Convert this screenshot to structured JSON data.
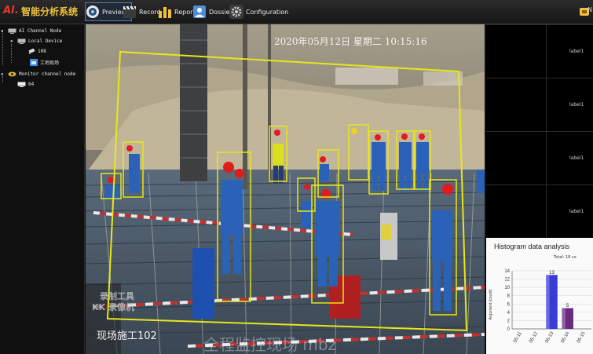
{
  "app": {
    "logo": "AI.",
    "title": "智能分析系统"
  },
  "nav": [
    {
      "label": "Preview",
      "icon": "camera-icon"
    },
    {
      "label": "Record",
      "icon": "clapperboard-icon"
    },
    {
      "label": "Report",
      "icon": "bar-chart-icon"
    },
    {
      "label": "Dossier",
      "icon": "user-card-icon"
    },
    {
      "label": "Configuration",
      "icon": "gear-icon"
    }
  ],
  "topright": {
    "label": "N"
  },
  "tree": {
    "ai_channel": "AI Channel Node",
    "local_device": "Local Device",
    "cam_108": "108",
    "site": "工地现场",
    "monitor_channel": "Monitor channel node",
    "cam_64": "64"
  },
  "video": {
    "timestamp": "2020年05月12日  星期二  10:15:16",
    "site_label": "现场施工102",
    "wm1": "录制工具",
    "wm2": "KK 录像机",
    "wm3": "全程监控现场 mbz"
  },
  "cells": [
    {
      "label": "label1"
    },
    {
      "label": "label1"
    },
    {
      "label": "label1"
    },
    {
      "label": "label1"
    }
  ],
  "histogram": {
    "title": "Histogram data analysis",
    "total": "Total: 18 co",
    "ylabel": "Argument (count)"
  },
  "chart_data": {
    "type": "bar",
    "title": "Histogram data analysis",
    "ylabel": "Argument (count)",
    "categories": [
      "05-11",
      "05-12",
      "05-13",
      "05-14",
      "05-15"
    ],
    "values": [
      0,
      0,
      13,
      5,
      0
    ],
    "data_labels": [
      "",
      "",
      "13",
      "5",
      ""
    ],
    "bar_colors": [
      "#3a3ad8",
      "#3a3ad8",
      "#3a3ad8",
      "#6a2a80",
      "#3a3ad8"
    ],
    "ylim": [
      0,
      14
    ],
    "yticks": [
      0,
      2,
      4,
      6,
      8,
      10,
      12,
      14
    ],
    "grid": true
  },
  "colors": {
    "accent": "#f0c23a",
    "box": "#e8e61a",
    "logo": "#e23b2a"
  }
}
